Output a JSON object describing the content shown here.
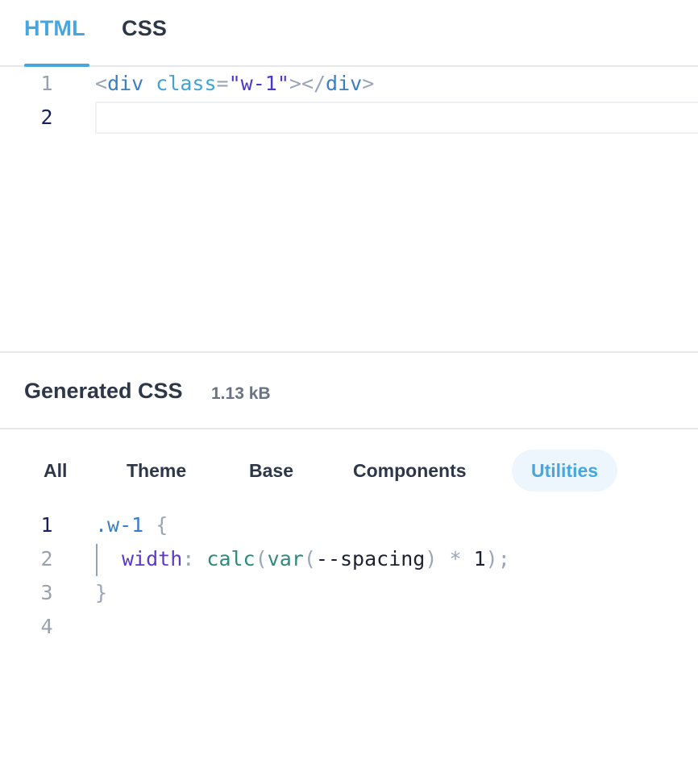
{
  "tabs": [
    {
      "label": "HTML",
      "active": true
    },
    {
      "label": "CSS",
      "active": false
    }
  ],
  "editor": {
    "line_numbers": [
      "1",
      "2"
    ],
    "line1": {
      "lt": "<",
      "tag": "div",
      "attr": "class",
      "eq": "=",
      "str": "\"w-1\"",
      "gt": ">",
      "close_lt": "</",
      "close_tag": "div",
      "close_gt": ">"
    }
  },
  "generated": {
    "title": "Generated CSS",
    "size": "1.13 kB"
  },
  "filters": [
    {
      "label": "All",
      "active": false
    },
    {
      "label": "Theme",
      "active": false
    },
    {
      "label": "Base",
      "active": false
    },
    {
      "label": "Components",
      "active": false
    },
    {
      "label": "Utilities",
      "active": true
    }
  ],
  "output": {
    "line_numbers": [
      "1",
      "2",
      "3",
      "4"
    ],
    "selector": ".w-1",
    "open_brace": "{",
    "property": "width",
    "colon": ":",
    "fn_calc": "calc",
    "paren_open": "(",
    "fn_var": "var",
    "var_name": "--spacing",
    "paren_close": ")",
    "op": "*",
    "num": "1",
    "end": ");",
    "close_brace": "}"
  },
  "colors": {
    "accent": "#48a6de",
    "active_filter_bg": "#eef6fd"
  }
}
